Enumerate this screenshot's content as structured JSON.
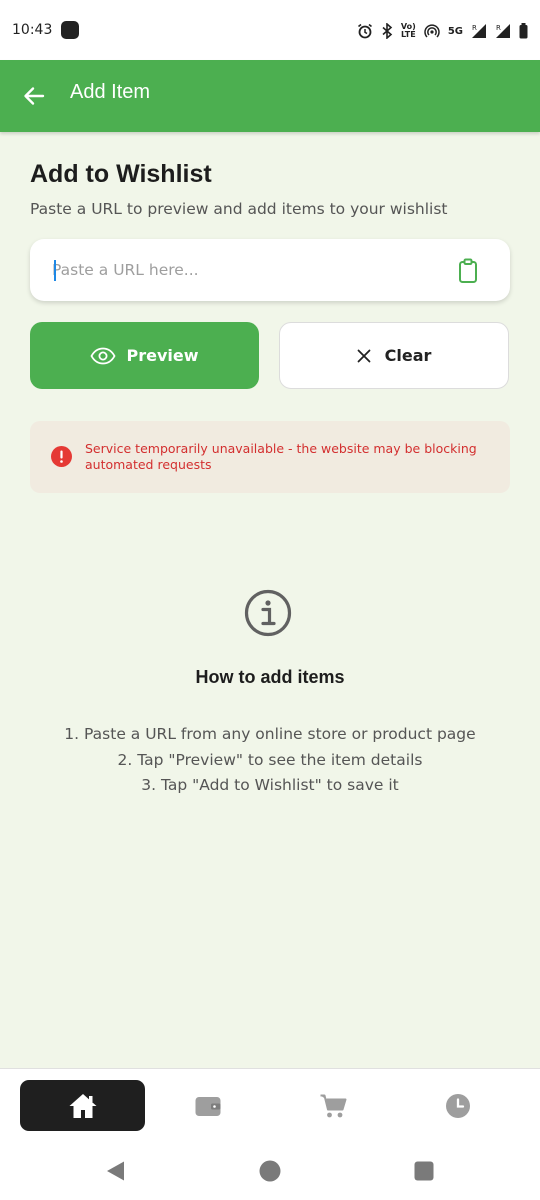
{
  "status_bar": {
    "time": "10:43",
    "volte_top": "Vo)",
    "volte_bottom": "LTE",
    "network": "5G"
  },
  "app_bar": {
    "title": "Add Item",
    "back_icon": "arrow-left-icon"
  },
  "main": {
    "heading": "Add to Wishlist",
    "subheading": "Paste a URL to preview and add items to your wishlist",
    "url_input": {
      "value": "",
      "placeholder": "Paste a URL here..."
    },
    "preview_label": "Preview",
    "clear_label": "Clear",
    "error_message": "Service temporarily unavailable - the website may be blocking automated requests"
  },
  "howto": {
    "title": "How to add items",
    "steps": [
      "1. Paste a URL from any online store or product page",
      "2. Tap \"Preview\" to see the item details",
      "3. Tap \"Add to Wishlist\" to save it"
    ]
  },
  "bottom_nav": {
    "items": [
      {
        "icon": "home-icon",
        "active": true
      },
      {
        "icon": "wallet-icon",
        "active": false
      },
      {
        "icon": "cart-icon",
        "active": false
      },
      {
        "icon": "clock-icon",
        "active": false
      }
    ]
  },
  "colors": {
    "primary": "#4caf50",
    "background": "#f1f6e9",
    "error": "#d32f2f",
    "error_bg": "#f1ebe0"
  }
}
